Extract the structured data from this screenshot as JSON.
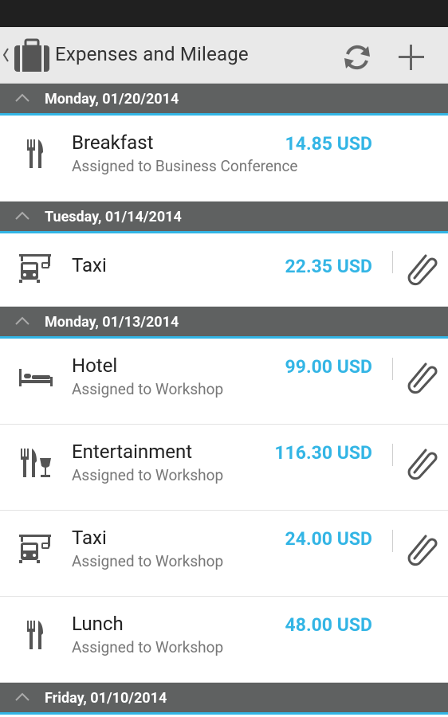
{
  "action_bar": {
    "title": "Expenses and Mileage",
    "refresh_icon": "refresh-icon",
    "add_icon": "add-icon"
  },
  "sections": [
    {
      "date": "Monday, 01/20/2014",
      "items": [
        {
          "icon": "fork-knife-icon",
          "name": "Breakfast",
          "assigned": "Assigned to Business Conference",
          "amount": "14.85 USD",
          "attachment": false
        }
      ]
    },
    {
      "date": "Tuesday, 01/14/2014",
      "items": [
        {
          "icon": "taxi-icon",
          "name": "Taxi",
          "assigned": "",
          "amount": "22.35 USD",
          "attachment": true
        }
      ]
    },
    {
      "date": "Monday, 01/13/2014",
      "items": [
        {
          "icon": "bed-icon",
          "name": "Hotel",
          "assigned": "Assigned to Workshop",
          "amount": "99.00 USD",
          "attachment": true
        },
        {
          "icon": "fork-knife-glass-icon",
          "name": "Entertainment",
          "assigned": "Assigned to Workshop",
          "amount": "116.30 USD",
          "attachment": true
        },
        {
          "icon": "taxi-icon",
          "name": "Taxi",
          "assigned": "Assigned to Workshop",
          "amount": "24.00 USD",
          "attachment": true
        },
        {
          "icon": "fork-knife-icon",
          "name": "Lunch",
          "assigned": "Assigned to Workshop",
          "amount": "48.00 USD",
          "attachment": false
        }
      ]
    },
    {
      "date": "Friday, 01/10/2014",
      "items": []
    }
  ],
  "colors": {
    "accent": "#33b5e5",
    "header_bg": "#5f6161",
    "actionbar_bg": "#e9e9e9",
    "statusbar_bg": "#202020"
  }
}
